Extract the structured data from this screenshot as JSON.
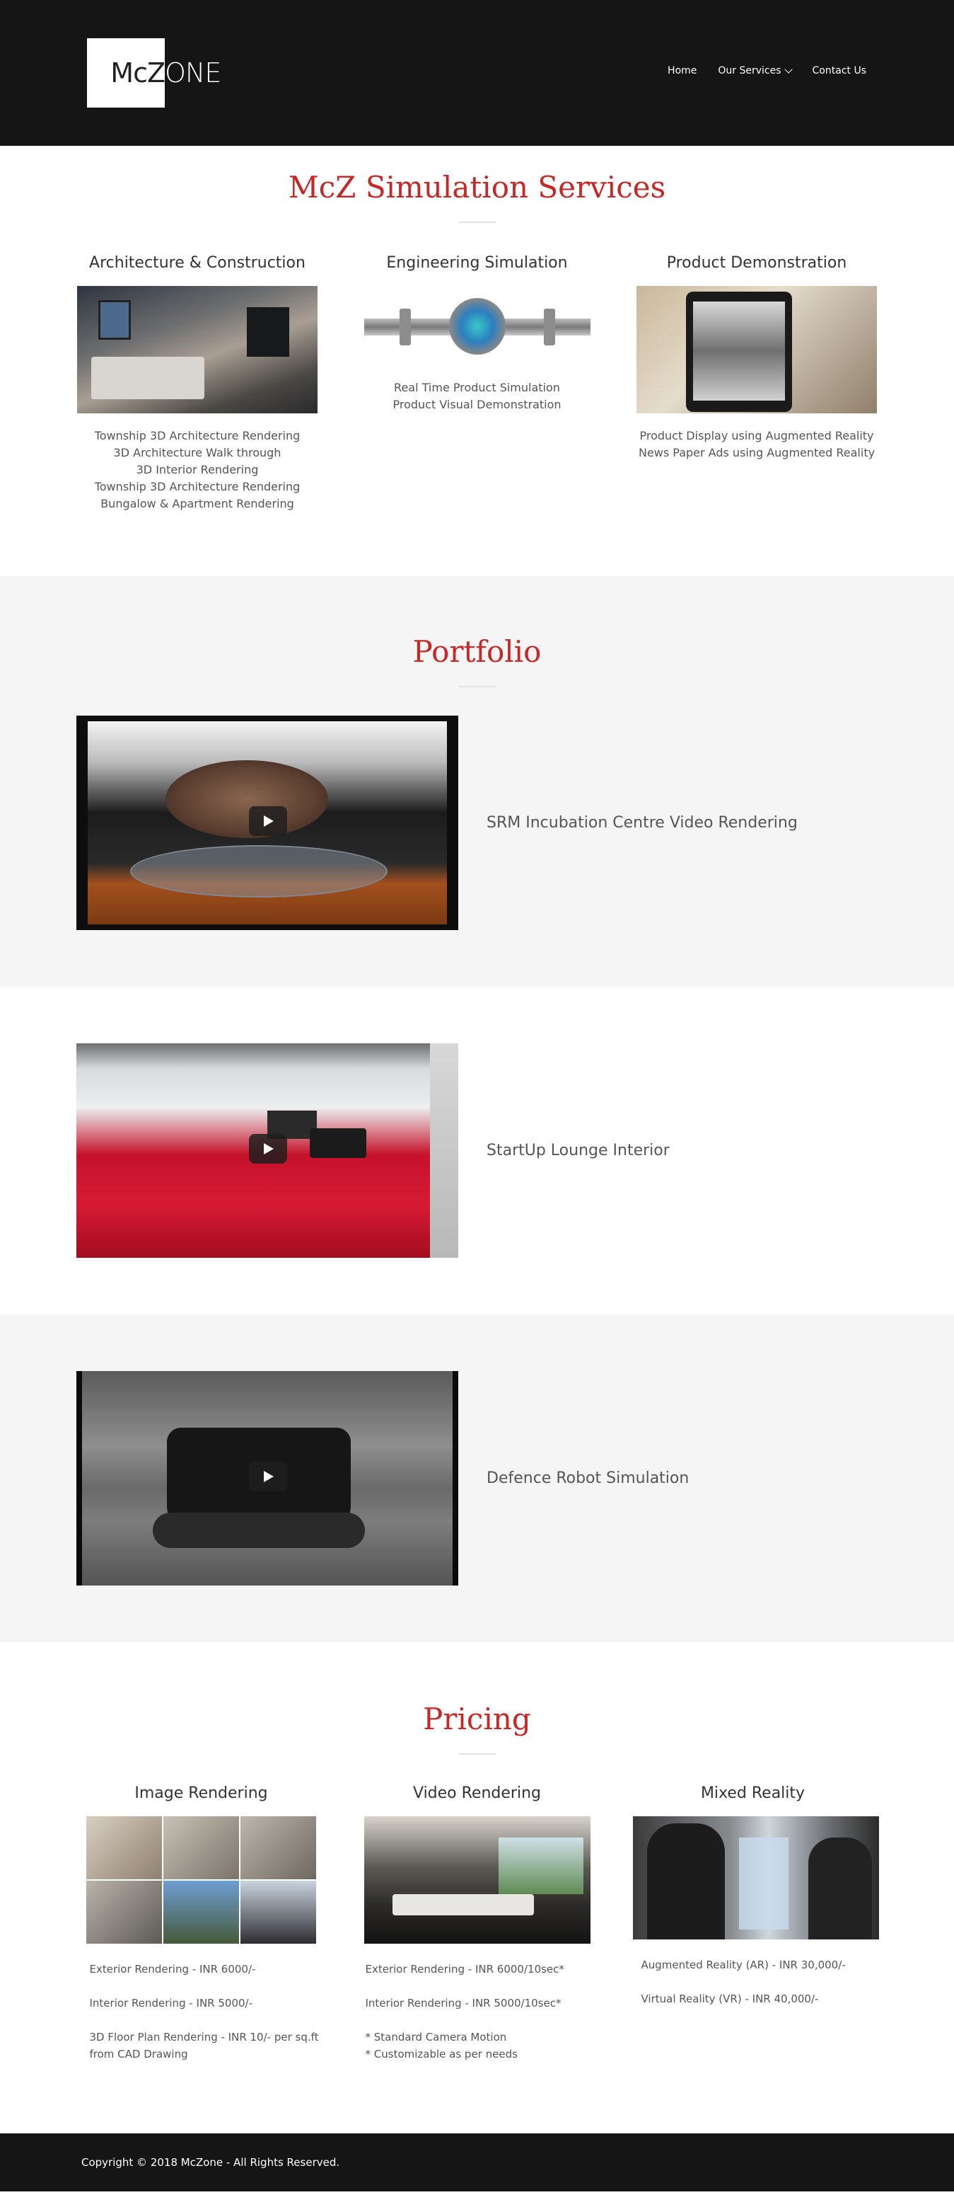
{
  "header": {
    "logo_mc": "McZ",
    "logo_one": "ONE",
    "nav": [
      {
        "label": "Home"
      },
      {
        "label": "Our Services"
      },
      {
        "label": "Contact Us"
      }
    ]
  },
  "services": {
    "title": "McZ Simulation Services",
    "columns": [
      {
        "heading": "Architecture & Construction",
        "lines": [
          "Township 3D Architecture Rendering",
          "3D Architecture Walk through",
          "3D Interior Rendering",
          "Township 3D Architecture Rendering",
          "Bungalow & Apartment Rendering"
        ]
      },
      {
        "heading": "Engineering Simulation",
        "lines": [
          "Real Time Product Simulation",
          "Product Visual Demonstration"
        ]
      },
      {
        "heading": "Product Demonstration",
        "lines": [
          "Product Display using Augmented Reality",
          "News Paper Ads using Augmented Reality"
        ]
      }
    ]
  },
  "portfolio": {
    "title": "Portfolio",
    "items": [
      {
        "caption": "SRM Incubation Centre Video Rendering"
      },
      {
        "caption": "StartUp Lounge Interior"
      },
      {
        "caption": "Defence Robot Simulation"
      }
    ]
  },
  "pricing": {
    "title": "Pricing",
    "columns": [
      {
        "heading": "Image Rendering",
        "items": [
          "Exterior Rendering - INR 6000/-",
          "Interior Rendering - INR 5000/-",
          "3D Floor Plan Rendering - INR 10/- per sq.ft",
          "from CAD Drawing"
        ]
      },
      {
        "heading": "Video Rendering",
        "items": [
          "Exterior Rendering - INR 6000/10sec*",
          "Interior Rendering - INR 5000/10sec*",
          "* Standard Camera Motion",
          "* Customizable as per needs"
        ]
      },
      {
        "heading": "Mixed Reality",
        "items": [
          "Augmented Reality (AR) - INR 30,000/-",
          "Virtual Reality (VR) - INR 40,000/-"
        ]
      }
    ]
  },
  "footer": {
    "copyright": "Copyright © 2018 McZone - All Rights Reserved."
  },
  "colors": {
    "accent_red": "#c62828",
    "header_bg": "#151515",
    "section_gray": "#f5f5f5"
  }
}
